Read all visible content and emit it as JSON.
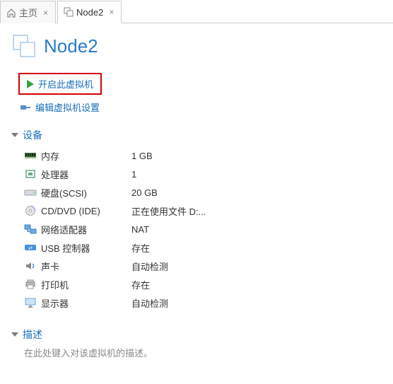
{
  "tabs": {
    "home": "主页",
    "node": "Node2"
  },
  "title": "Node2",
  "actions": {
    "power_on": "开启此虚拟机",
    "edit_settings": "编辑虚拟机设置"
  },
  "sections": {
    "devices": "设备",
    "description": "描述"
  },
  "devices": [
    {
      "icon": "memory",
      "label": "内存",
      "value": "1 GB"
    },
    {
      "icon": "cpu",
      "label": "处理器",
      "value": "1"
    },
    {
      "icon": "disk",
      "label": "硬盘(SCSI)",
      "value": "20 GB"
    },
    {
      "icon": "cd",
      "label": "CD/DVD (IDE)",
      "value": "正在使用文件 D:..."
    },
    {
      "icon": "net",
      "label": "网络适配器",
      "value": "NAT"
    },
    {
      "icon": "usb",
      "label": "USB 控制器",
      "value": "存在"
    },
    {
      "icon": "sound",
      "label": "声卡",
      "value": "自动检测"
    },
    {
      "icon": "printer",
      "label": "打印机",
      "value": "存在"
    },
    {
      "icon": "display",
      "label": "显示器",
      "value": "自动检测"
    }
  ],
  "description_placeholder": "在此处键入对该虚拟机的描述。"
}
